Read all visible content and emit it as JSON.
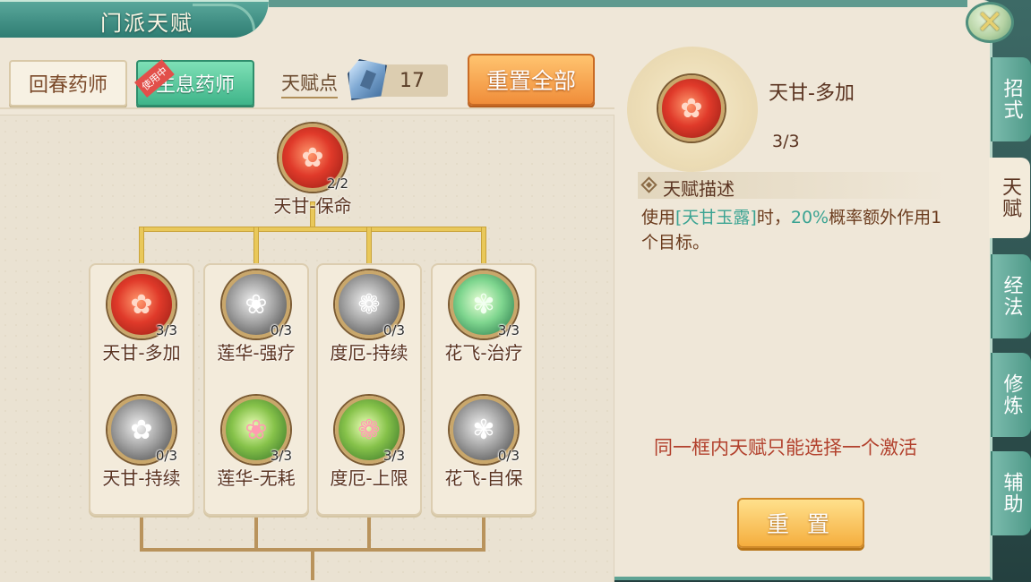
{
  "window": {
    "title": "门派天赋",
    "close_icon": "close-x-icon"
  },
  "classes": [
    {
      "label": "回春药师",
      "active": false
    },
    {
      "label": "生息药师",
      "active": true,
      "badge": "使用中"
    }
  ],
  "points": {
    "label": "天赋点",
    "value": "17",
    "icon": "crystal-icon"
  },
  "reset_all_label": "重置全部",
  "root": {
    "name": "天甘-保命",
    "count": "2/2"
  },
  "columns": [
    {
      "nodes": [
        {
          "name": "天甘-多加",
          "count": "3/3"
        },
        {
          "name": "天甘-持续",
          "count": "0/3"
        }
      ]
    },
    {
      "nodes": [
        {
          "name": "莲华-强疗",
          "count": "0/3"
        },
        {
          "name": "莲华-无耗",
          "count": "3/3"
        }
      ]
    },
    {
      "nodes": [
        {
          "name": "度厄-持续",
          "count": "0/3"
        },
        {
          "name": "度厄-上限",
          "count": "3/3"
        }
      ]
    },
    {
      "nodes": [
        {
          "name": "花飞-治疗",
          "count": "3/3"
        },
        {
          "name": "花飞-自保",
          "count": "0/3"
        }
      ]
    }
  ],
  "detail": {
    "name": "天甘-多加",
    "level": "3/3",
    "desc_title": "天赋描述",
    "desc_prefix": "使用",
    "desc_skill": "[天甘玉露]",
    "desc_mid": "时，",
    "desc_rate": "20%",
    "desc_suffix": "概率额外作用1个目标。",
    "notice": "同一框内天赋只能选择一个激活",
    "reset_label": "重 置"
  },
  "side_tabs": [
    {
      "label": "招式",
      "active": false
    },
    {
      "label": "天赋",
      "active": true
    },
    {
      "label": "经法",
      "active": false
    },
    {
      "label": "修炼",
      "active": false
    },
    {
      "label": "辅助",
      "active": false
    }
  ],
  "colors": {
    "accent": "#3fb489",
    "reset_all": "#f08d3a",
    "reset": "#f5ae3e",
    "notice": "#b2402c",
    "highlight": "#3aa392"
  }
}
